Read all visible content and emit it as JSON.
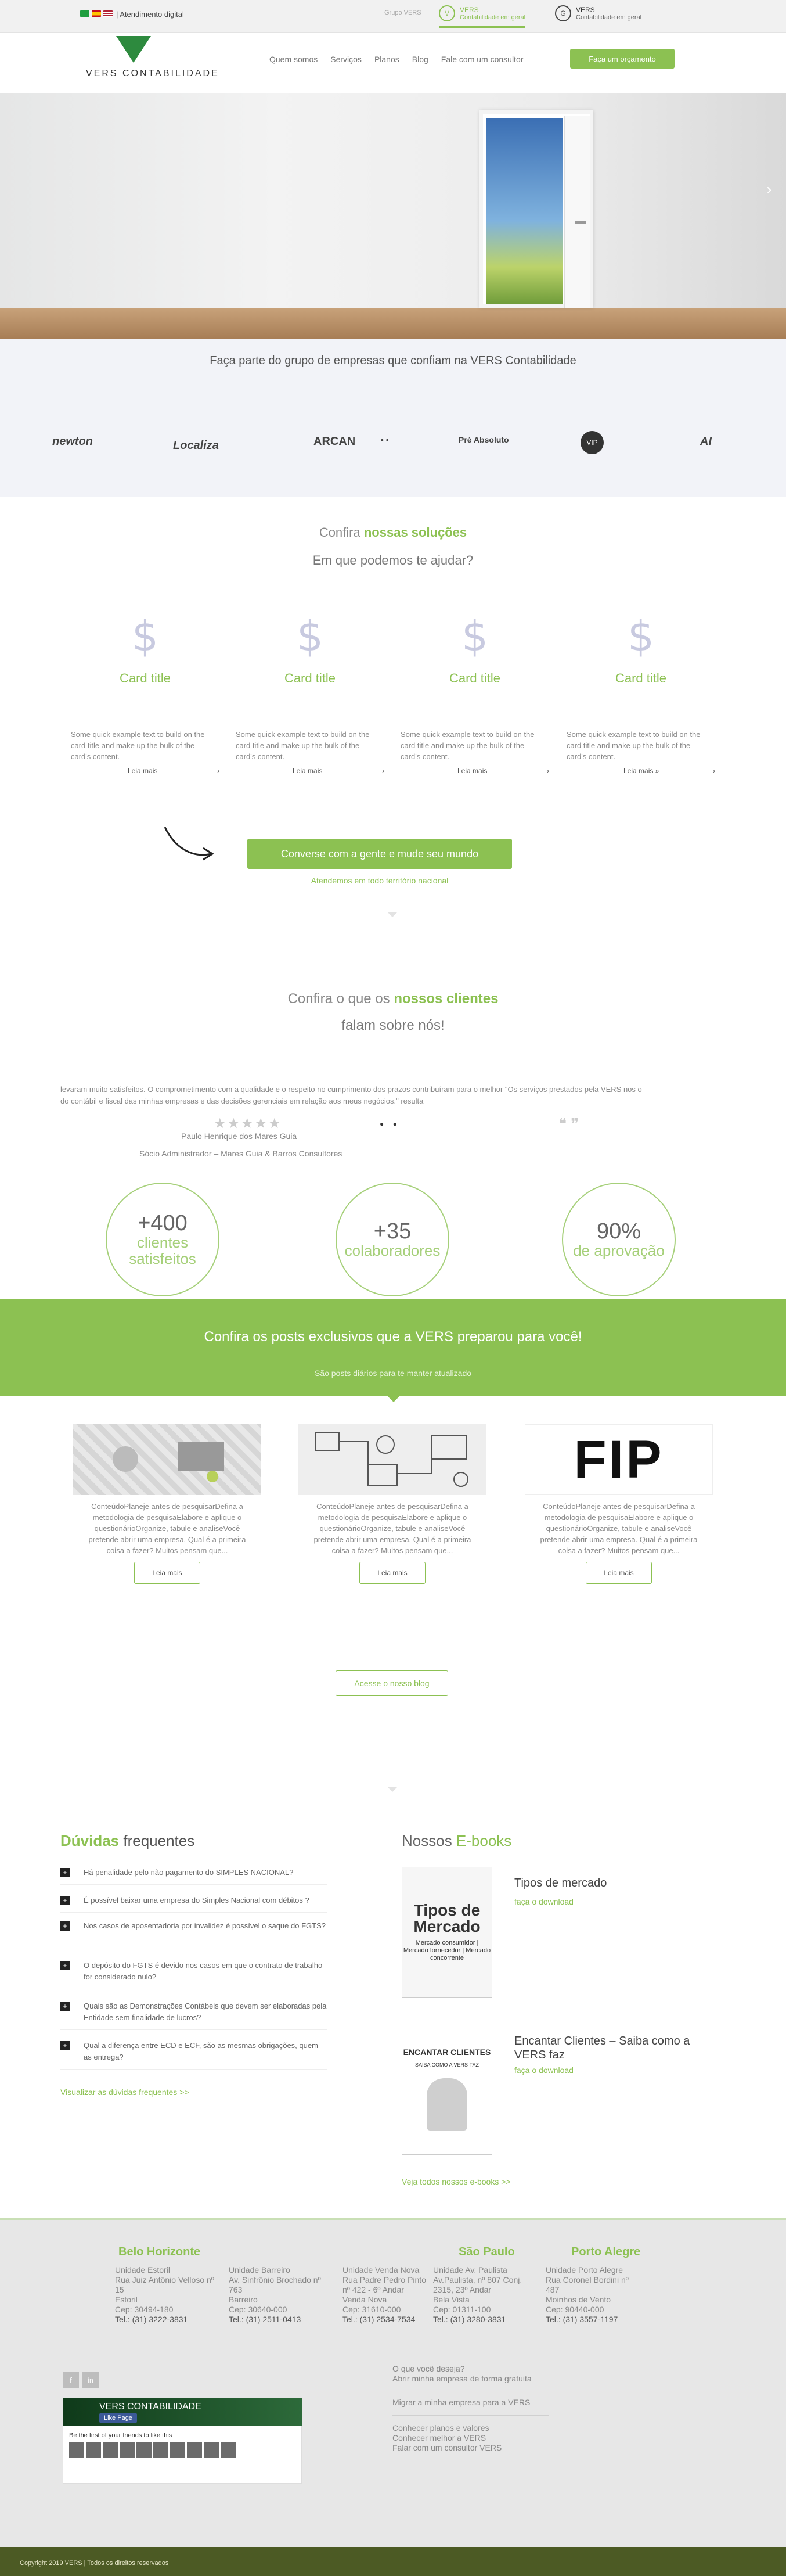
{
  "topbar": {
    "attendance": "| Atendimento digital",
    "group_label": "Grupo VERS",
    "brand1": {
      "name": "VERS",
      "sub": "Contabilidade em geral",
      "icon": "V"
    },
    "brand2": {
      "name": "VERS",
      "sub": "Contabilidade em geral",
      "icon": "G"
    }
  },
  "header": {
    "logo_text": "VERS CONTABILIDADE",
    "nav": [
      "Quem somos",
      "Serviços",
      "Planos",
      "Blog",
      "Fale com um consultor"
    ],
    "cta": "Faça um orçamento"
  },
  "hero": {
    "next_arrow": "›"
  },
  "partners": {
    "title": "Faça parte do grupo de empresas que confiam na VERS Contabilidade",
    "logos": [
      "newton",
      "Localiza",
      "ARCAN",
      "• •",
      "Pré Absoluto",
      "VIP",
      "AI"
    ]
  },
  "solutions": {
    "title_plain": "Confira ",
    "title_green": "nossas soluções",
    "subtitle": "Em que podemos te ajudar?",
    "cards": [
      {
        "icon": "$",
        "title": "Card title",
        "text": "Some quick example text to build on the card title and make up the bulk of the card's content.",
        "more": "Leia mais",
        "arrow": "›"
      },
      {
        "icon": "$",
        "title": "Card title",
        "text": "Some quick example text to build on the card title and make up the bulk of the card's content.",
        "more": "Leia mais",
        "arrow": "›"
      },
      {
        "icon": "$",
        "title": "Card title",
        "text": "Some quick example text to build on the card title and make up the bulk of the card's content.",
        "more": "Leia mais",
        "arrow": "›"
      },
      {
        "icon": "$",
        "title": "Card title",
        "text": "Some quick example text to build on the card title and make up the bulk of the card's content.",
        "more": "Leia mais »",
        "arrow": "›"
      }
    ],
    "cta": "Converse com a gente e mude seu mundo",
    "cta_sub": "Atendemos em todo território nacional"
  },
  "clients": {
    "title_plain": "Confira o que os ",
    "title_green": "nossos clientes",
    "subtitle": "falam sobre nós!",
    "testimonial_line1": "levaram muito satisfeitos. O comprometimento com a qualidade e o respeito no cumprimento dos prazos contribuíram para o melhor \"Os serviços prestados pela VERS nos o",
    "testimonial_line2": "do contábil e fiscal das minhas empresas e das decisões gerenciais em relação aos meus negócios.\"                                                                                                  resulta",
    "stars": "★★★★★",
    "dots": "● ●",
    "quotes": "❝ ❞",
    "name": "Paulo Henrique dos Mares Guia",
    "role": "Sócio Administrador – Mares Guia & Barros Consultores"
  },
  "stats": [
    {
      "number": "+400",
      "label1": "clientes",
      "label2": "satisfeitos"
    },
    {
      "number": "+35",
      "label1": "colaboradores",
      "label2": ""
    },
    {
      "number": "90%",
      "label1": "de aprovação",
      "label2": ""
    }
  ],
  "blog": {
    "title": "Confira os posts exclusivos que a VERS preparou para você!",
    "subtitle": "São posts diários para te manter atualizado",
    "posts": [
      {
        "text": "ConteúdoPlaneje antes de pesquisarDefina a metodologia de pesquisaElabore e aplique o questionárioOrganize, tabule e analiseVocê pretende abrir uma empresa. Qual é a primeira coisa a fazer? Muitos pensam que...",
        "button": "Leia mais"
      },
      {
        "text": "ConteúdoPlaneje antes de pesquisarDefina a metodologia de pesquisaElabore e aplique o questionárioOrganize, tabule e analiseVocê pretende abrir uma empresa. Qual é a primeira coisa a fazer? Muitos pensam que...",
        "button": "Leia mais"
      },
      {
        "text": "ConteúdoPlaneje antes de pesquisarDefina a metodologia de pesquisaElabore e aplique o questionárioOrganize, tabule e analiseVocê pretende abrir uma empresa. Qual é a primeira coisa a fazer? Muitos pensam que...",
        "button": "Leia mais"
      }
    ],
    "post3_image_text": "FIP",
    "cta": "Acesse o nosso blog"
  },
  "faq": {
    "title_green": "Dúvidas",
    "title_plain": " frequentes",
    "items": [
      {
        "plus": "+",
        "q": "Há penalidade pelo não pagamento do SIMPLES NACIONAL?"
      },
      {
        "plus": "+",
        "q": "É possível baixar uma empresa do Simples Nacional com débitos ?"
      },
      {
        "plus": "+",
        "q": "Nos casos de aposentadoria por invalidez é possível o saque do FGTS?"
      },
      {
        "plus": "+",
        "q": "O depósito do FGTS é devido nos casos em que o contrato de trabalho for considerado nulo?"
      },
      {
        "plus": "+",
        "q": "Quais são as Demonstrações Contábeis que devem ser elaboradas pela Entidade sem finalidade de lucros?"
      },
      {
        "plus": "+",
        "q": "Qual a diferença entre ECD e ECF, são as mesmas obrigações, quem as entrega?"
      }
    ],
    "more": "Visualizar as dúvidas frequentes >>"
  },
  "ebooks": {
    "title_plain": "Nossos ",
    "title_green": "E-books",
    "books": [
      {
        "cover_title": "Tipos de Mercado",
        "cover_lines": "Mercado consumidor | Mercado fornecedor | Mercado concorrente",
        "name": "Tipos de mercado",
        "download": "faça o download"
      },
      {
        "cover_title": "ENCANTAR CLIENTES",
        "cover_lines": "SAIBA COMO A VERS FAZ",
        "name": "Encantar Clientes – Saiba como a VERS faz",
        "download": "faça o download"
      }
    ],
    "more": "Veja todos nossos e-books >>"
  },
  "footer": {
    "cities": [
      "Belo Horizonte",
      "São Paulo",
      "Porto Alegre"
    ],
    "units": [
      {
        "name": "Unidade Estoril",
        "addr": "Rua Juiz Antônio Velloso nº 15",
        "bairro": "Estoril",
        "cep": "Cep: 30494-180",
        "tel": "Tel.: (31) 3222-3831"
      },
      {
        "name": "Unidade Barreiro",
        "addr": "Av. Sinfrônio Brochado nº 763",
        "bairro": "Barreiro",
        "cep": "Cep: 30640-000",
        "tel": "Tel.: (31) 2511-0413"
      },
      {
        "name": "Unidade Venda Nova",
        "addr": "Rua Padre Pedro Pinto nº 422 - 6º Andar",
        "bairro": "Venda Nova",
        "cep": "Cep: 31610-000",
        "tel": "Tel.: (31) 2534-7534"
      },
      {
        "name": "Unidade Av. Paulista",
        "addr": "Av.Paulista, nº 807 Conj. 2315, 23º Andar",
        "bairro": "Bela Vista",
        "cep": "Cep: 01311-100",
        "tel": "Tel.: (31) 3280-3831"
      },
      {
        "name": "Unidade Porto Alegre",
        "addr": "Rua Coronel Bordini nº 487",
        "bairro": "Moinhos de Vento",
        "cep": "Cep: 90440-000",
        "tel": "Tel.: (31) 3557-1197"
      }
    ],
    "social": [
      "f",
      "in"
    ],
    "fb_page": "VERS CONTABILIDADE",
    "fb_like": "Like Page",
    "fb_sub": "Be the first of your friends to like this",
    "links": [
      [
        "O que você deseja?",
        "Abrir minha empresa de forma gratuita"
      ],
      [
        "Migrar a minha empresa para a VERS"
      ],
      [
        "Conhecer planos e valores",
        "Conhecer melhor a VERS",
        "Falar com um consultor VERS"
      ]
    ],
    "copyright": "Copyright 2019 VERS | Todos os direitos reservados"
  }
}
